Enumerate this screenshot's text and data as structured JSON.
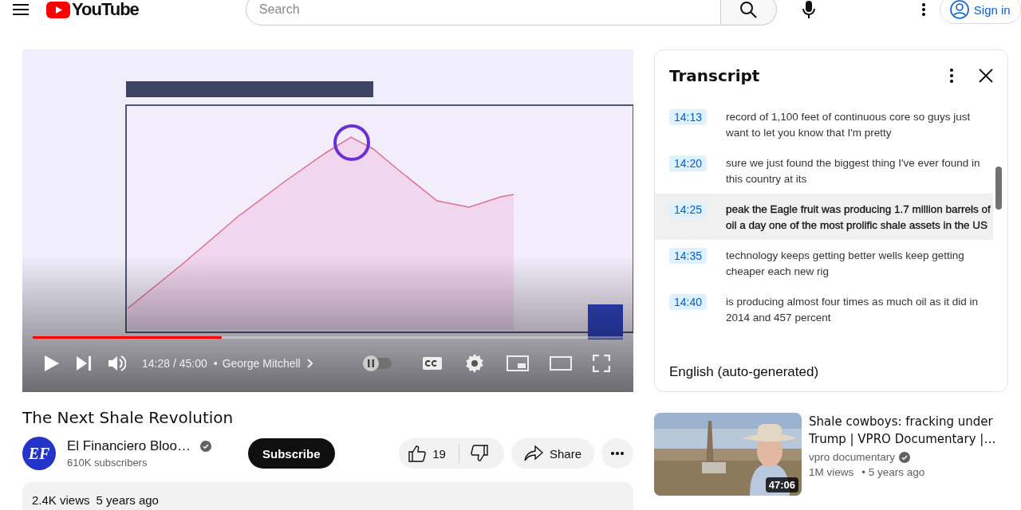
{
  "header": {
    "logo": "YouTube",
    "search": {
      "placeholder": "Search"
    },
    "sign_in": "Sign in"
  },
  "player": {
    "progress": {
      "level": 0.32
    },
    "time": "14:28 / 45:00",
    "separator": "•",
    "chapter": "George Mitchell",
    "autoplay_on": false
  },
  "video": {
    "title": "The Next Shale Revolution",
    "channel": {
      "avatar": "EF",
      "name": "El Financiero Bloo…",
      "verified": true,
      "subscribers": "610K subscribers"
    },
    "subscribe": "Subscribe",
    "likes": "19",
    "share": "Share",
    "views": "2.4K views",
    "age": "5 years ago"
  },
  "transcript": {
    "title": "Transcript",
    "segments": [
      {
        "time": "14:13",
        "text": "record of 1,100 feet of continuous core so guys just want to let you know that I'm pretty",
        "selected": false
      },
      {
        "time": "14:20",
        "text": "sure we just found the biggest thing I've ever found in this country at its",
        "selected": false
      },
      {
        "time": "14:25",
        "text": "peak the Eagle fruit was producing 1.7 million barrels of oil a day one of the most prolific shale assets in the US",
        "selected": true
      },
      {
        "time": "14:35",
        "text": "technology keeps getting better wells keep getting cheaper each new rig",
        "selected": false
      },
      {
        "time": "14:40",
        "text": "is producing almost four times as much oil as it did in 2014 and 457 percent",
        "selected": false
      }
    ],
    "language": "English (auto-generated)"
  },
  "recommended": [
    {
      "duration": "47:06",
      "title": "Shale cowboys: fracking under Trump | VPRO Documentary |…",
      "channel": "vpro documentary",
      "verified": true,
      "views": "1M views",
      "age": "• 5 years ago"
    }
  ]
}
